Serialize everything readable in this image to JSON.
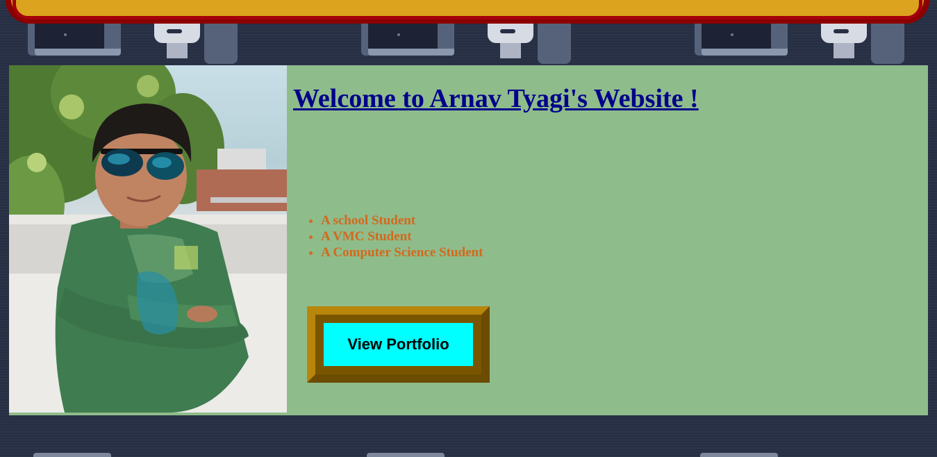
{
  "header": {
    "title": "Welcome to Arnav Tyagi's Website !"
  },
  "profile": {
    "photo_icon": "profile-photo",
    "roles": [
      "A school Student",
      "A VMC Student",
      "A Computer Science Student"
    ]
  },
  "actions": {
    "portfolio_label": "View Portfolio"
  },
  "colors": {
    "page_background": "#272f44",
    "banner_gold": "#dba31e",
    "banner_red": "#8b0000",
    "card_background": "#8fbc8b",
    "title_color": "#00008b",
    "list_color": "#d2691e",
    "button_color": "#00ffff",
    "button_frame": "#b8860b"
  }
}
